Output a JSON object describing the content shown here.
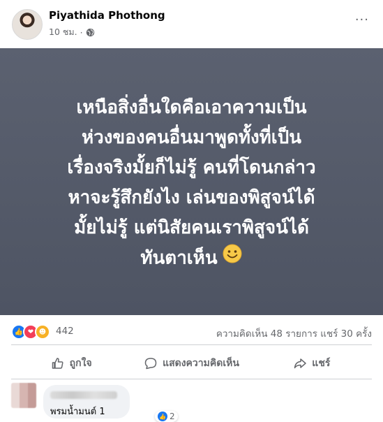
{
  "post": {
    "author": "Piyathida Phothong",
    "time": "10 ชม.",
    "separator": "·",
    "privacy_icon": "globe-icon",
    "more_label": "···"
  },
  "image_text": {
    "lines": "เหนือสิ่งอื่นใดคือเอาความเป็น\nห่วงของคนอื่นมาพูดทั้งที่เป็น\nเรื่องจริงมั้ยก็ไม่รู้ คนที่โดนกล่าว\nหาจะรู้สึกยังไง เล่นของพิสูจน์ได้\nมั้ยไม่รู้ แต่นิสัยคนเราพิสูจน์ได้\nทันตาเห็น",
    "background": "#535968",
    "emoji_icon": "smile-emoji-icon"
  },
  "stats": {
    "reaction_icons": [
      "like-reaction-icon",
      "love-reaction-icon",
      "care-reaction-icon"
    ],
    "reaction_count": "442",
    "comments_shares": "ความคิดเห็น 48 รายการ  แชร์ 30 ครั้ง"
  },
  "actions": {
    "like": "ถูกใจ",
    "comment": "แสดงความคิดเห็น",
    "share": "แชร์"
  },
  "comment": {
    "text": "พรมน้ำมนต์ 1",
    "reaction_count": "2"
  },
  "colors": {
    "accent": "#1877f2",
    "muted": "#65676b",
    "love": "#f33e58",
    "care": "#f7b125"
  }
}
